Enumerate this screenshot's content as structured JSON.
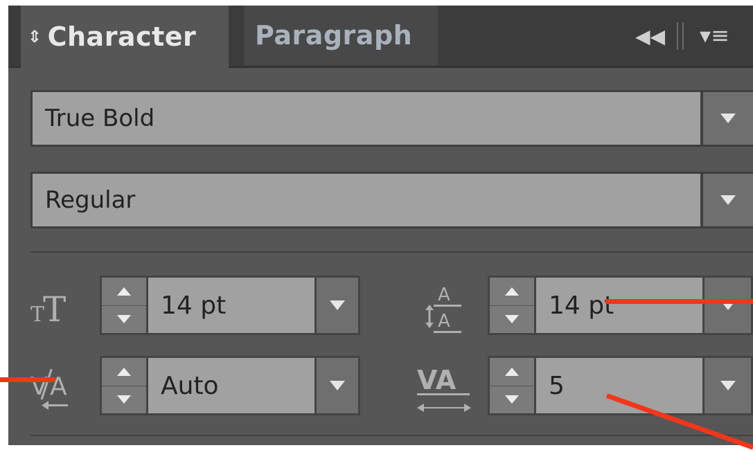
{
  "tabs": {
    "active": {
      "icon": "updown-arrows-icon",
      "label": "Character"
    },
    "inactive": {
      "label": "Paragraph"
    },
    "collapse_icon": "double-chevron-left-icon",
    "menu_icon": "panel-menu-icon"
  },
  "font_family": {
    "value": "True Bold"
  },
  "font_style": {
    "value": "Regular"
  },
  "font_size": {
    "icon": "font-size-icon",
    "value": "14 pt"
  },
  "leading": {
    "icon": "leading-icon",
    "value": "14 pt"
  },
  "kerning": {
    "icon": "kerning-icon",
    "value": "Auto"
  },
  "tracking": {
    "icon": "tracking-icon",
    "value": "5"
  },
  "annotations": {
    "color": "#f2361a",
    "count": 3
  },
  "colors": {
    "panel_bg": "#565656",
    "field_bg": "#a1a1a1",
    "tabbar_bg": "#3c3c3c"
  }
}
